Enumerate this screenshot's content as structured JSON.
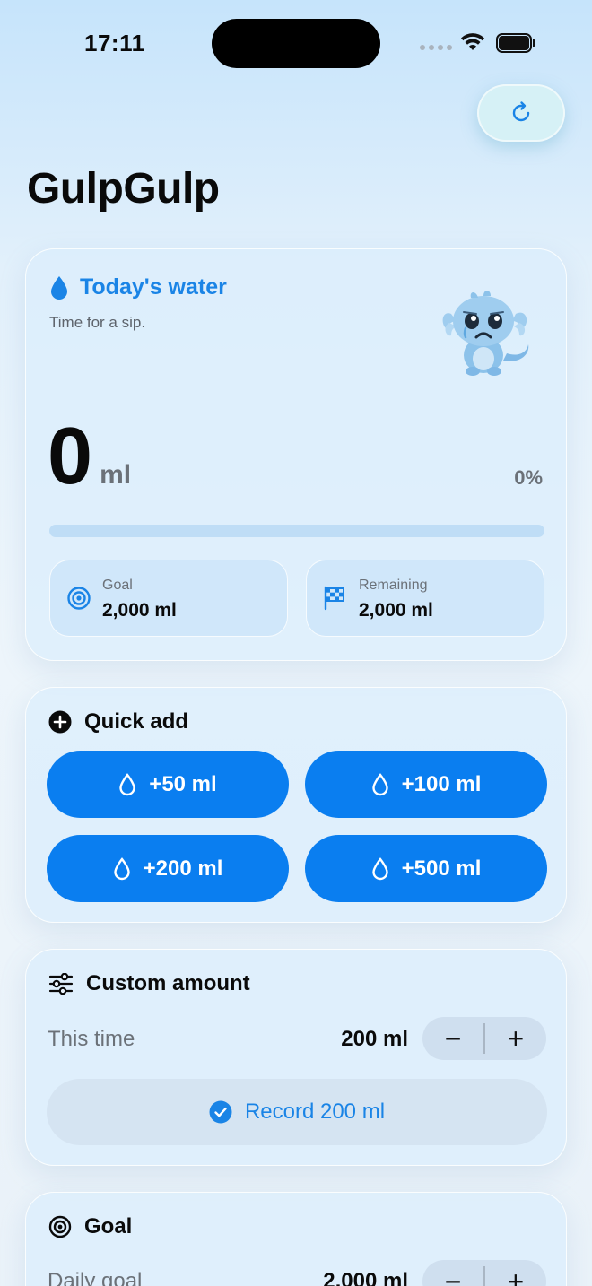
{
  "status_bar": {
    "time": "17:11"
  },
  "app": {
    "title": "GulpGulp"
  },
  "today": {
    "title": "Today's water",
    "subtitle": "Time for a sip.",
    "amount": "0",
    "unit": "ml",
    "percent": "0%",
    "progress_fraction": 0,
    "goal_label": "Goal",
    "goal_value": "2,000 ml",
    "remaining_label": "Remaining",
    "remaining_value": "2,000 ml"
  },
  "quick_add": {
    "title": "Quick add",
    "buttons": [
      "+50 ml",
      "+100 ml",
      "+200 ml",
      "+500 ml"
    ]
  },
  "custom": {
    "title": "Custom amount",
    "row_label": "This time",
    "row_value": "200 ml",
    "minus": "−",
    "plus": "+",
    "record_label": "Record 200 ml"
  },
  "goal": {
    "title": "Goal",
    "row_label": "Daily goal",
    "row_value": "2,000 ml",
    "minus": "−",
    "plus": "+"
  },
  "colors": {
    "accent": "#1a84e6",
    "button_blue": "#0a7ef0",
    "progress_track": "#bfddf6"
  },
  "icons": {
    "refresh": "refresh-icon",
    "drop": "water-drop-icon",
    "target": "target-icon",
    "flag": "checkered-flag-icon",
    "plus_circle": "plus-circle-icon",
    "sliders": "sliders-icon",
    "check": "checkmark-circle-icon",
    "mascot": "sad-water-creature-mascot"
  }
}
